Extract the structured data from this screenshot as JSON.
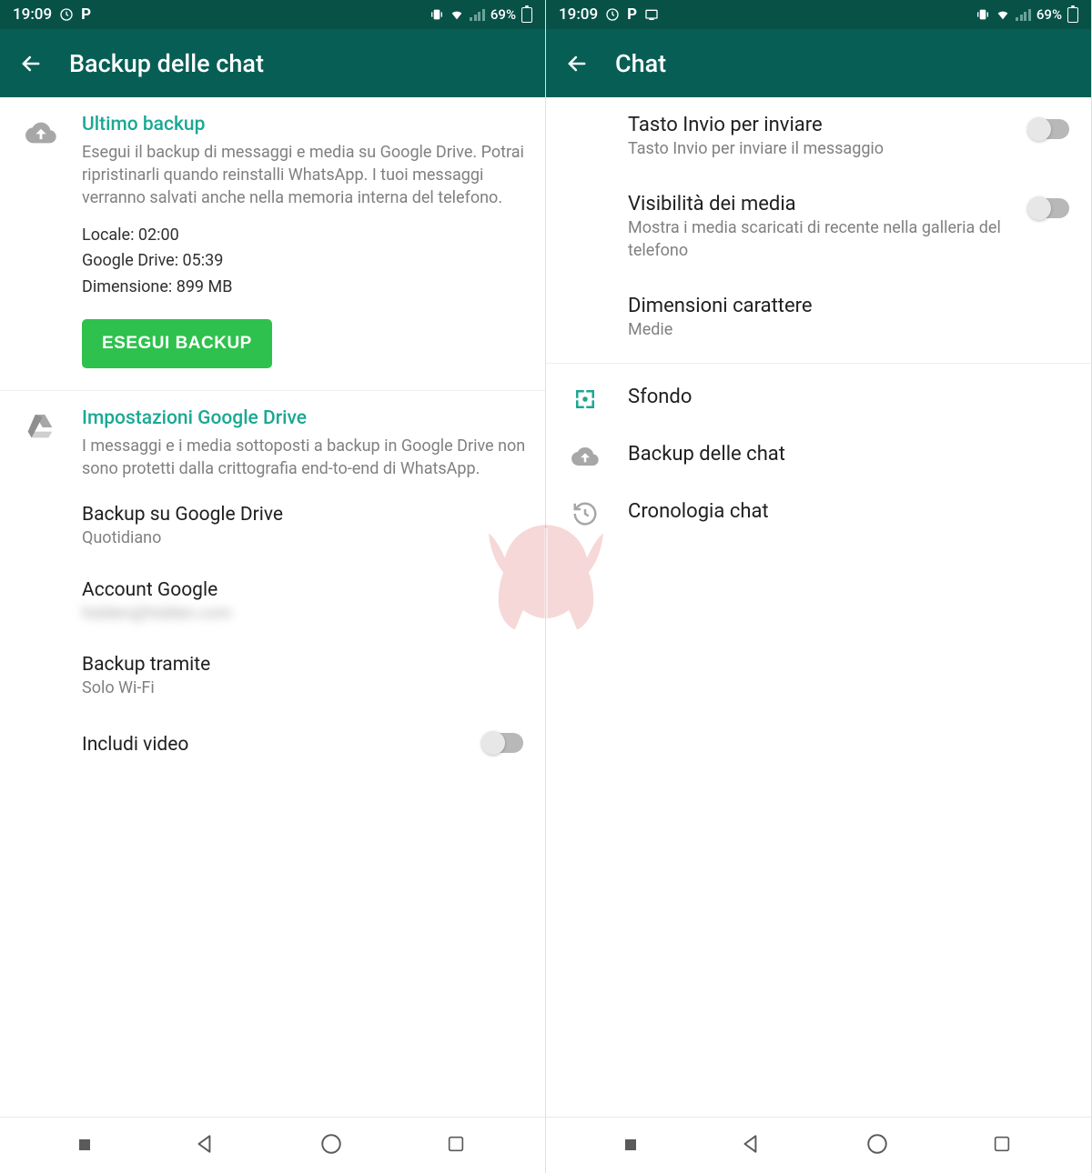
{
  "status": {
    "time": "19:09",
    "battery_text": "69%"
  },
  "left": {
    "title": "Backup delle chat",
    "last_backup": {
      "heading": "Ultimo backup",
      "desc": "Esegui il backup di messaggi e media su Google Drive. Potrai ripristinarli quando reinstalli WhatsApp. I tuoi messaggi verranno salvati anche nella memoria interna del telefono.",
      "local_label": "Locale: 02:00",
      "drive_label": "Google Drive: 05:39",
      "size_label": "Dimensione: 899 MB",
      "button": "ESEGUI BACKUP"
    },
    "gdrive": {
      "heading": "Impostazioni Google Drive",
      "desc": "I messaggi e i media sottoposti a backup in Google Drive non sono protetti dalla crittografia end-to-end di WhatsApp.",
      "freq_title": "Backup su Google Drive",
      "freq_value": "Quotidiano",
      "account_title": "Account Google",
      "account_value": "hidden@hidden.com",
      "via_title": "Backup tramite",
      "via_value": "Solo Wi-Fi",
      "include_video": "Includi video"
    }
  },
  "right": {
    "title": "Chat",
    "enter_send": {
      "title": "Tasto Invio per inviare",
      "sub": "Tasto Invio per inviare il messaggio"
    },
    "media_vis": {
      "title": "Visibilità dei media",
      "sub": "Mostra i media scaricati di recente nella galleria del telefono"
    },
    "font_size": {
      "title": "Dimensioni carattere",
      "sub": "Medie"
    },
    "wallpaper": "Sfondo",
    "backup": "Backup delle chat",
    "history": "Cronologia chat"
  }
}
